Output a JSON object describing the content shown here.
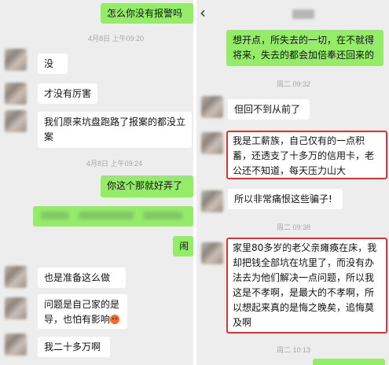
{
  "left": {
    "ts1": "4月8日 上午09:20",
    "ts2": "4月8日 上午09:24",
    "out1": "怎么你没有报警吗",
    "in1": "没有",
    "in2": "才没有厉害",
    "in3": "我们原来坑盘跑路了报案的都没立案",
    "out2": "你这个那就好弄了",
    "out3": "闹",
    "in4": "也是准备这么做",
    "in5": "问题是自己家的是导，也怕有影响",
    "in6": "我二十多万啊"
  },
  "right": {
    "out1": "想开点，所失去的一切，在不就得将来，失去的都会加倍奉还回来的",
    "ts1": "周二 09:32",
    "in1": "但回不到从前了",
    "in2": "我是工薪族，自己仅有的一点积蓄，还透支了十多万的信用卡，老公还不知道，每天压力山大",
    "in3": "所以非常痛恨这些骗子!",
    "ts2": "周二 09:38",
    "in4": "家里80多岁的老父亲瘫痪在床，我却把钱全部坑在坑里了，而没有办法去为他们解决一点问题，所以我这是不孝啊，是最大的不孝啊，所以想起来真的是悔之晚矣，追悔莫及啊",
    "ts3": "周二 10:13"
  },
  "icons": {
    "back": "back-chevron-icon",
    "emoji": "angry-face-icon"
  },
  "colors": {
    "out_bubble": "#95ec69",
    "in_bubble": "#ffffff",
    "highlight_box": "#e0312f",
    "chat_bg": "#ededed"
  }
}
